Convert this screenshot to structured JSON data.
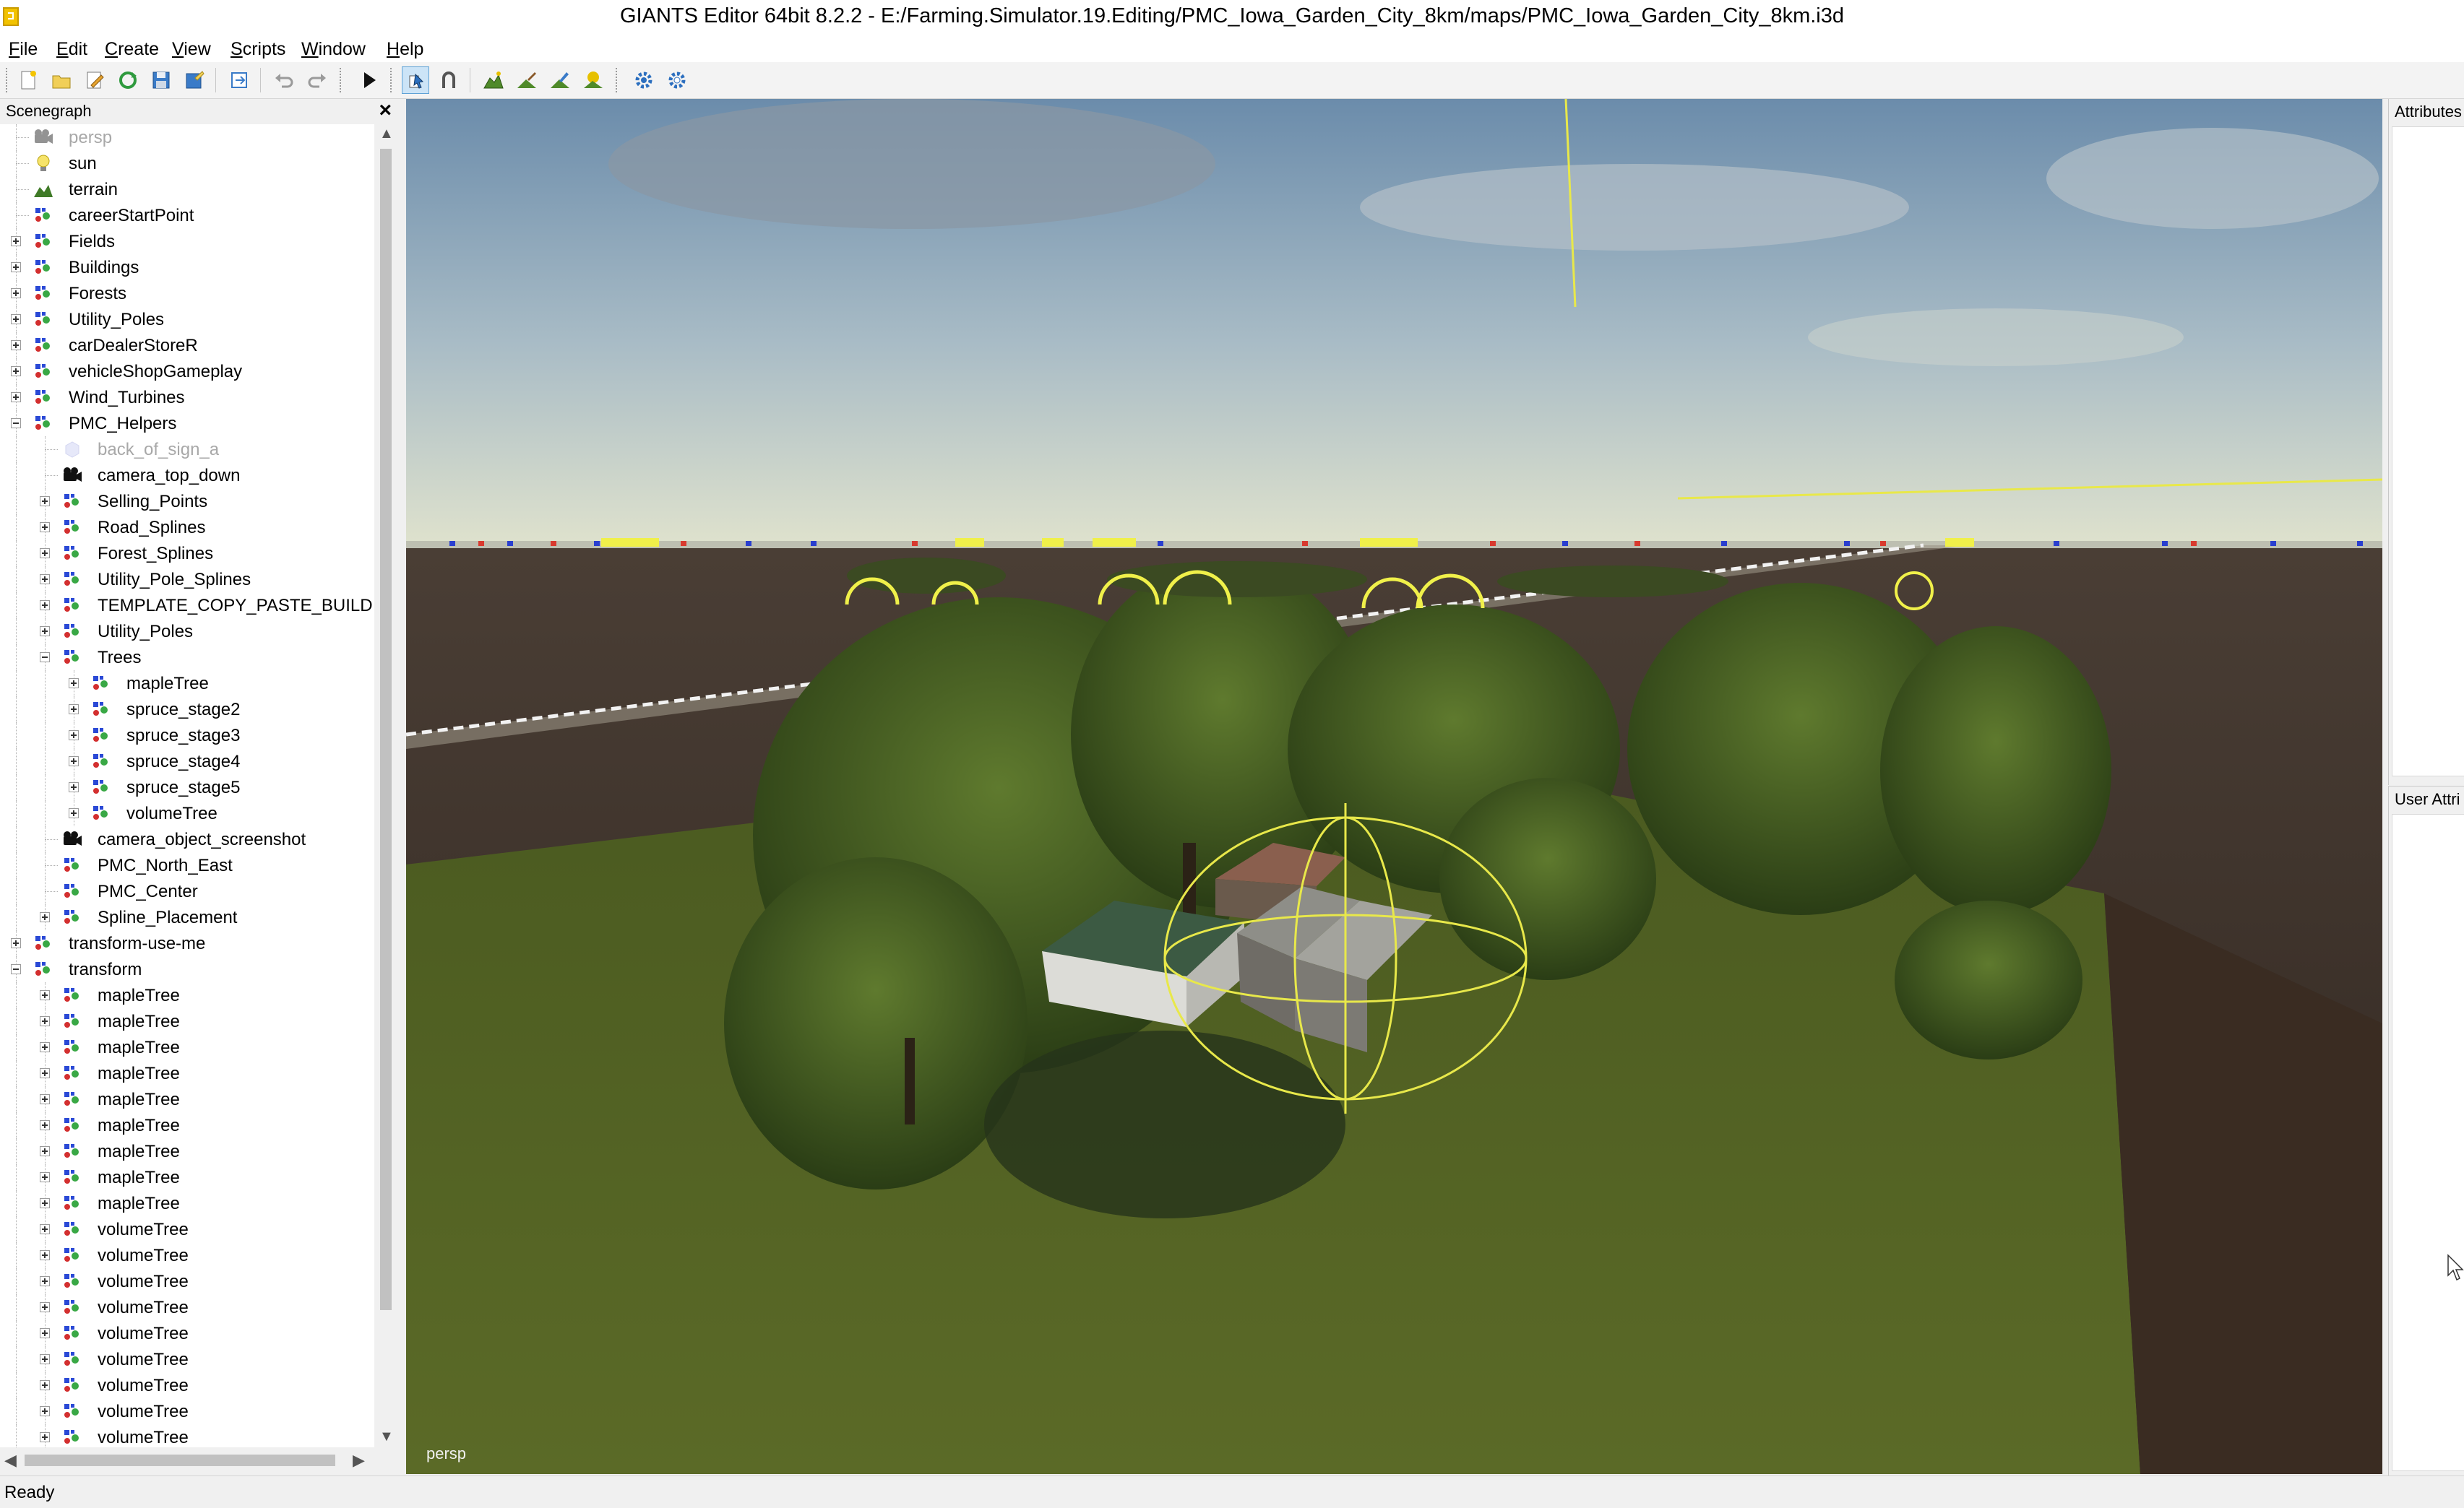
{
  "window": {
    "title": "GIANTS Editor 64bit 8.2.2 - E:/Farming.Simulator.19.Editing/PMC_Iowa_Garden_City_8km/maps/PMC_Iowa_Garden_City_8km.i3d"
  },
  "menu": {
    "items": [
      {
        "key": "F",
        "rest": "ile"
      },
      {
        "key": "E",
        "rest": "dit"
      },
      {
        "key": "C",
        "rest": "reate"
      },
      {
        "key": "V",
        "rest": "iew"
      },
      {
        "key": "S",
        "rest": "cripts"
      },
      {
        "key": "W",
        "rest": "indow"
      },
      {
        "key": "H",
        "rest": "elp"
      }
    ]
  },
  "toolbar": {
    "buttons": [
      "new-file-icon",
      "open-file-icon",
      "edit-file-icon",
      "refresh-icon",
      "save-icon",
      "save-as-icon",
      "export-icon",
      "undo-icon",
      "redo-icon",
      "play-icon",
      "select-mode-icon",
      "move-mode-icon",
      "terrain-sculpt-icon",
      "terrain-paint-icon",
      "foliage-paint-icon",
      "placement-icon",
      "settings-icon",
      "settings-alt-icon"
    ]
  },
  "scenegraph": {
    "title": "Scenegraph",
    "close": "×",
    "nodes": [
      {
        "label": "persp",
        "depth": 0,
        "icon": "camera",
        "expander": "none",
        "dim": true
      },
      {
        "label": "sun",
        "depth": 0,
        "icon": "light",
        "expander": "none"
      },
      {
        "label": "terrain",
        "depth": 0,
        "icon": "terrain",
        "expander": "none"
      },
      {
        "label": "careerStartPoint",
        "depth": 0,
        "icon": "transform",
        "expander": "none"
      },
      {
        "label": "Fields",
        "depth": 0,
        "icon": "transform",
        "expander": "plus"
      },
      {
        "label": "Buildings",
        "depth": 0,
        "icon": "transform",
        "expander": "plus"
      },
      {
        "label": "Forests",
        "depth": 0,
        "icon": "transform",
        "expander": "plus"
      },
      {
        "label": "Utility_Poles",
        "depth": 0,
        "icon": "transform",
        "expander": "plus"
      },
      {
        "label": "carDealerStoreR",
        "depth": 0,
        "icon": "transform",
        "expander": "plus"
      },
      {
        "label": "vehicleShopGameplay",
        "depth": 0,
        "icon": "transform",
        "expander": "plus"
      },
      {
        "label": "Wind_Turbines",
        "depth": 0,
        "icon": "transform",
        "expander": "plus"
      },
      {
        "label": "PMC_Helpers",
        "depth": 0,
        "icon": "transform",
        "expander": "minus"
      },
      {
        "label": "back_of_sign_a",
        "depth": 1,
        "icon": "shape",
        "expander": "none",
        "dim": true
      },
      {
        "label": "camera_top_down",
        "depth": 1,
        "icon": "camera",
        "expander": "none"
      },
      {
        "label": "Selling_Points",
        "depth": 1,
        "icon": "transform",
        "expander": "plus"
      },
      {
        "label": "Road_Splines",
        "depth": 1,
        "icon": "transform",
        "expander": "plus"
      },
      {
        "label": "Forest_Splines",
        "depth": 1,
        "icon": "transform",
        "expander": "plus"
      },
      {
        "label": "Utility_Pole_Splines",
        "depth": 1,
        "icon": "transform",
        "expander": "plus"
      },
      {
        "label": "TEMPLATE_COPY_PASTE_BUILD",
        "depth": 1,
        "icon": "transform",
        "expander": "plus"
      },
      {
        "label": "Utility_Poles",
        "depth": 1,
        "icon": "transform",
        "expander": "plus"
      },
      {
        "label": "Trees",
        "depth": 1,
        "icon": "transform",
        "expander": "minus"
      },
      {
        "label": "mapleTree",
        "depth": 2,
        "icon": "transform",
        "expander": "plus"
      },
      {
        "label": "spruce_stage2",
        "depth": 2,
        "icon": "transform",
        "expander": "plus"
      },
      {
        "label": "spruce_stage3",
        "depth": 2,
        "icon": "transform",
        "expander": "plus"
      },
      {
        "label": "spruce_stage4",
        "depth": 2,
        "icon": "transform",
        "expander": "plus"
      },
      {
        "label": "spruce_stage5",
        "depth": 2,
        "icon": "transform",
        "expander": "plus"
      },
      {
        "label": "volumeTree",
        "depth": 2,
        "icon": "transform",
        "expander": "plus"
      },
      {
        "label": "camera_object_screenshot",
        "depth": 1,
        "icon": "camera",
        "expander": "none"
      },
      {
        "label": "PMC_North_East",
        "depth": 1,
        "icon": "transform",
        "expander": "none"
      },
      {
        "label": "PMC_Center",
        "depth": 1,
        "icon": "transform",
        "expander": "none"
      },
      {
        "label": "Spline_Placement",
        "depth": 1,
        "icon": "transform",
        "expander": "plus"
      },
      {
        "label": "transform-use-me",
        "depth": 0,
        "icon": "transform",
        "expander": "plus"
      },
      {
        "label": "transform",
        "depth": 0,
        "icon": "transform",
        "expander": "minus"
      },
      {
        "label": "mapleTree",
        "depth": 1,
        "icon": "transform",
        "expander": "plus"
      },
      {
        "label": "mapleTree",
        "depth": 1,
        "icon": "transform",
        "expander": "plus"
      },
      {
        "label": "mapleTree",
        "depth": 1,
        "icon": "transform",
        "expander": "plus"
      },
      {
        "label": "mapleTree",
        "depth": 1,
        "icon": "transform",
        "expander": "plus"
      },
      {
        "label": "mapleTree",
        "depth": 1,
        "icon": "transform",
        "expander": "plus"
      },
      {
        "label": "mapleTree",
        "depth": 1,
        "icon": "transform",
        "expander": "plus"
      },
      {
        "label": "mapleTree",
        "depth": 1,
        "icon": "transform",
        "expander": "plus"
      },
      {
        "label": "mapleTree",
        "depth": 1,
        "icon": "transform",
        "expander": "plus"
      },
      {
        "label": "mapleTree",
        "depth": 1,
        "icon": "transform",
        "expander": "plus"
      },
      {
        "label": "volumeTree",
        "depth": 1,
        "icon": "transform",
        "expander": "plus"
      },
      {
        "label": "volumeTree",
        "depth": 1,
        "icon": "transform",
        "expander": "plus"
      },
      {
        "label": "volumeTree",
        "depth": 1,
        "icon": "transform",
        "expander": "plus"
      },
      {
        "label": "volumeTree",
        "depth": 1,
        "icon": "transform",
        "expander": "plus"
      },
      {
        "label": "volumeTree",
        "depth": 1,
        "icon": "transform",
        "expander": "plus"
      },
      {
        "label": "volumeTree",
        "depth": 1,
        "icon": "transform",
        "expander": "plus"
      },
      {
        "label": "volumeTree",
        "depth": 1,
        "icon": "transform",
        "expander": "plus"
      },
      {
        "label": "volumeTree",
        "depth": 1,
        "icon": "transform",
        "expander": "plus"
      },
      {
        "label": "volumeTree",
        "depth": 1,
        "icon": "transform",
        "expander": "plus"
      }
    ]
  },
  "viewport": {
    "camera_label": "persp"
  },
  "attributes": {
    "title": "Attributes"
  },
  "user_attributes": {
    "title": "User Attri"
  },
  "status": {
    "text": "Ready"
  },
  "colors": {
    "sky_top": "#6f8fae",
    "sky_horizon": "#d6dcc7",
    "field_dark": "#3b2f26",
    "grass": "#4d5a22",
    "selection_yellow": "#f0f04a"
  }
}
